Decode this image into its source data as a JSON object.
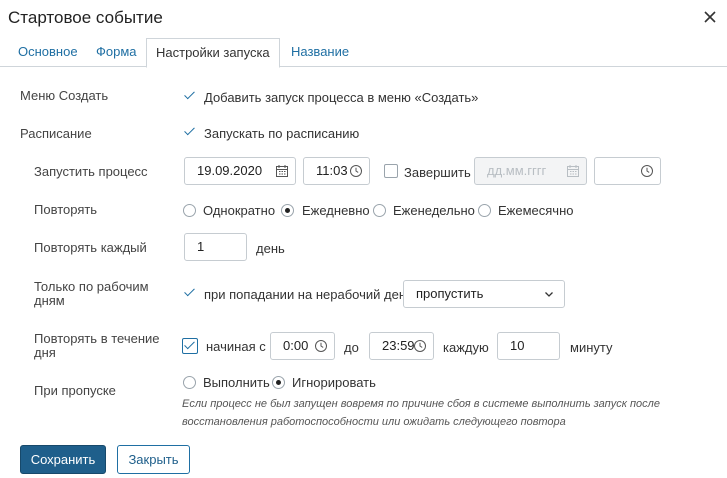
{
  "dialog": {
    "title": "Стартовое событие"
  },
  "tabs": [
    {
      "label": "Основное"
    },
    {
      "label": "Форма"
    },
    {
      "label": "Настройки запуска"
    },
    {
      "label": "Название"
    }
  ],
  "menu_create": {
    "label": "Меню Создать",
    "checkbox_label": "Добавить запуск процесса в меню «Создать»",
    "checked": true
  },
  "schedule": {
    "label": "Расписание",
    "checkbox_label": "Запускать по расписанию",
    "checked": true
  },
  "start_process": {
    "label": "Запустить процесс",
    "date_value": "19.09.2020",
    "time_value": "11:03",
    "finish_label": "Завершить",
    "finish_checked": false,
    "finish_date_placeholder": "дд.мм.гггг",
    "finish_time_value": ""
  },
  "repeat": {
    "label": "Повторять",
    "options": [
      "Однократно",
      "Ежедневно",
      "Еженедельно",
      "Ежемесячно"
    ],
    "selected": "Ежедневно"
  },
  "repeat_every": {
    "label": "Повторять каждый",
    "value": "1",
    "unit": "день"
  },
  "workdays_only": {
    "label_line1": "Только по рабочим",
    "label_line2": "дням",
    "checkbox_label": "при попадании на нерабочий день",
    "checked": true,
    "select_value": "пропустить"
  },
  "repeat_during_day": {
    "label_line1": "Повторять в течение",
    "label_line2": "дня",
    "checkbox_label": "начиная с",
    "checked": true,
    "from_value": "0:00",
    "to_label": "до",
    "to_value": "23:59",
    "every_label": "каждую",
    "every_value": "10",
    "unit": "минуту"
  },
  "on_skip": {
    "label": "При пропуске",
    "options": [
      "Выполнить",
      "Игнорировать"
    ],
    "selected": "Игнорировать",
    "hint": "Если процесс не был запущен вовремя по причине сбоя в системе выполнить запуск после восстановления работоспособности или ожидать следующего повтора"
  },
  "buttons": {
    "save": "Сохранить",
    "close": "Закрыть"
  },
  "colors": {
    "accent": "#1f6fa3",
    "primary_button": "#1f5f8b"
  }
}
